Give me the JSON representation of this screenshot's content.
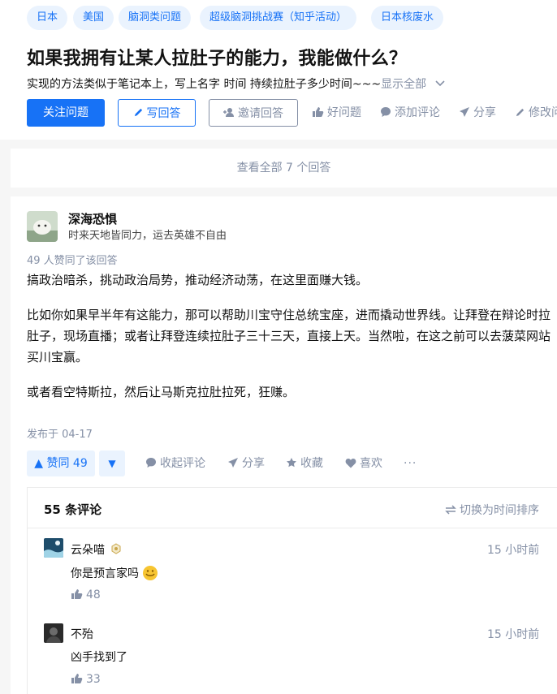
{
  "topics": [
    "日本",
    "美国",
    "脑洞类问题",
    "超级脑洞挑战赛（知乎活动）",
    "日本核废水"
  ],
  "question": {
    "title": "如果我拥有让某人拉肚子的能力，我能做什么？",
    "desc": "实现的方法类似于笔记本上，写上名字 时间 持续拉肚子多少时间~~~",
    "show_all": "显示全部"
  },
  "buttons": {
    "follow": "关注问题",
    "write": "写回答",
    "invite": "邀请回答",
    "good_q": "好问题",
    "add_comment": "添加评论",
    "share": "分享",
    "edit": "修改问"
  },
  "view_all": "查看全部 7 个回答",
  "answer": {
    "author": "深海恐惧",
    "bio": "时来天地皆同力，运去英雄不自由",
    "votes_line": "49 人赞同了该回答",
    "paragraphs": [
      "搞政治暗杀，挑动政治局势，推动经济动荡，在这里面赚大钱。",
      "比如你如果早半年有这能力，那可以帮助川宝守住总统宝座，进而撬动世界线。让拜登在辩论时拉肚子，现场直播；或者让拜登连续拉肚子三十三天，直接上天。当然啦，在这之前可以去菠菜网站买川宝赢。",
      "或者看空特斯拉，然后让马斯克拉肚拉死，狂赚。"
    ],
    "published": "发布于 04-17",
    "vote_up": "▲ 赞同 49",
    "vote_down": "▼",
    "actions": {
      "collapse_comments": "收起评论",
      "share": "分享",
      "favorite": "收藏",
      "like": "喜欢",
      "more": "···"
    }
  },
  "comments": {
    "count_label": "55 条评论",
    "sort_label": "切换为时间排序",
    "items": [
      {
        "name": "云朵喵",
        "time": "15 小时前",
        "text": "你是预言家吗",
        "likes": "48"
      },
      {
        "name": "不殆",
        "time": "15 小时前",
        "text": "凶手找到了",
        "likes": "33"
      }
    ]
  },
  "colors": {
    "accent": "#1772f6",
    "muted": "#8590a6",
    "tag_bg": "#eaf3fe"
  }
}
